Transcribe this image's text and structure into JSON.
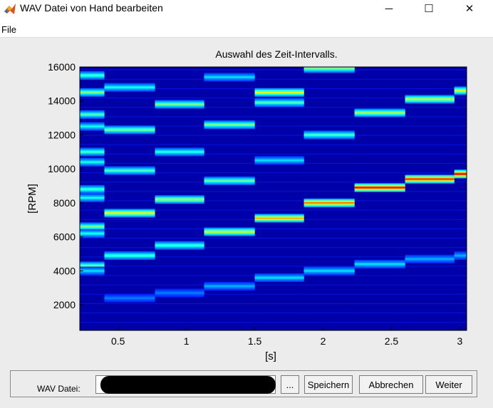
{
  "window": {
    "title": "WAV Datei von Hand bearbeiten",
    "controls": {
      "minimize": "─",
      "maximize": "☐",
      "close": "✕"
    }
  },
  "menu": {
    "file": "File"
  },
  "chart_data": {
    "type": "heatmap",
    "title": "Auswahl des Zeit-Intervalls.",
    "xlabel": "[s]",
    "ylabel": "[RPM]",
    "xlim": [
      0.22,
      3.05
    ],
    "ylim": [
      500,
      16000
    ],
    "xticks": [
      0.5,
      1,
      1.5,
      2,
      2.5,
      3
    ],
    "yticks": [
      2000,
      4000,
      6000,
      8000,
      10000,
      12000,
      14000,
      16000
    ],
    "grid": false,
    "colormap": "jet",
    "background_color": "#0000a8",
    "columns": [
      {
        "x0": 0.22,
        "x1": 0.4,
        "peaks": [
          [
            15500,
            0.45
          ],
          [
            14500,
            0.5
          ],
          [
            13200,
            0.45
          ],
          [
            12500,
            0.4
          ],
          [
            11000,
            0.45
          ],
          [
            10400,
            0.4
          ],
          [
            8800,
            0.45
          ],
          [
            8300,
            0.4
          ],
          [
            6600,
            0.5
          ],
          [
            6200,
            0.4
          ],
          [
            4300,
            0.5
          ],
          [
            4000,
            0.35
          ]
        ]
      },
      {
        "x0": 0.4,
        "x1": 0.77,
        "peaks": [
          [
            14800,
            0.4
          ],
          [
            12300,
            0.5
          ],
          [
            9900,
            0.45
          ],
          [
            7400,
            0.62
          ],
          [
            4900,
            0.45
          ],
          [
            2400,
            0.25
          ]
        ]
      },
      {
        "x0": 0.77,
        "x1": 1.13,
        "peaks": [
          [
            13800,
            0.5
          ],
          [
            11000,
            0.42
          ],
          [
            8200,
            0.55
          ],
          [
            5500,
            0.45
          ],
          [
            2700,
            0.25
          ]
        ]
      },
      {
        "x0": 1.13,
        "x1": 1.5,
        "peaks": [
          [
            15400,
            0.35
          ],
          [
            12600,
            0.5
          ],
          [
            9300,
            0.48
          ],
          [
            6300,
            0.6
          ],
          [
            3100,
            0.3
          ]
        ]
      },
      {
        "x0": 1.5,
        "x1": 1.86,
        "peaks": [
          [
            14500,
            0.62
          ],
          [
            13900,
            0.45
          ],
          [
            10500,
            0.35
          ],
          [
            7100,
            0.72
          ],
          [
            3600,
            0.35
          ]
        ]
      },
      {
        "x0": 1.86,
        "x1": 2.23,
        "peaks": [
          [
            15900,
            0.5
          ],
          [
            12000,
            0.45
          ],
          [
            8000,
            0.78
          ],
          [
            4000,
            0.35
          ]
        ]
      },
      {
        "x0": 2.23,
        "x1": 2.6,
        "peaks": [
          [
            13300,
            0.55
          ],
          [
            8900,
            0.9
          ],
          [
            4400,
            0.35
          ]
        ]
      },
      {
        "x0": 2.6,
        "x1": 2.96,
        "peaks": [
          [
            14100,
            0.58
          ],
          [
            9400,
            0.85
          ],
          [
            4700,
            0.3
          ]
        ]
      },
      {
        "x0": 2.96,
        "x1": 3.05,
        "peaks": [
          [
            14600,
            0.6
          ],
          [
            9700,
            0.92
          ],
          [
            4900,
            0.3
          ]
        ]
      }
    ]
  },
  "bottom": {
    "wav_label": "WAV Datei:",
    "wav_value": "",
    "browse": "...",
    "save": "Speichern",
    "cancel": "Abbrechen",
    "next": "Weiter"
  }
}
